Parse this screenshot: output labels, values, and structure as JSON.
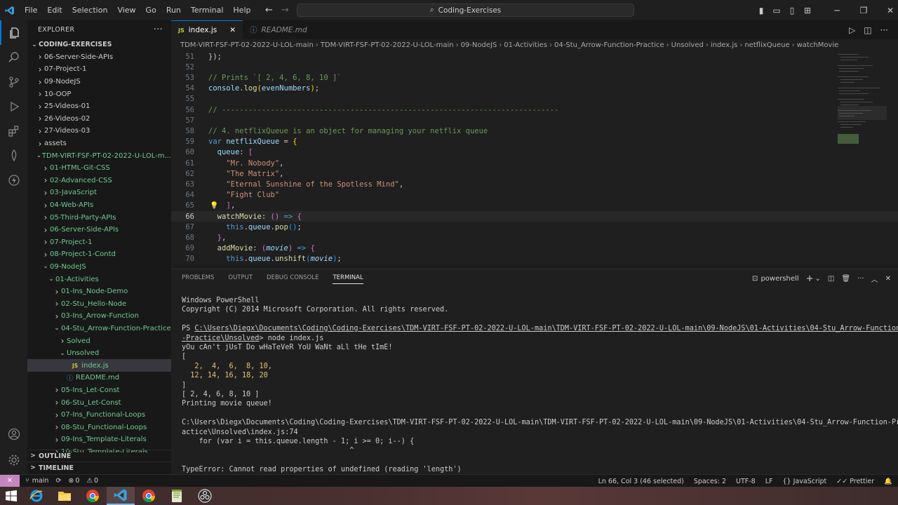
{
  "titlebar": {
    "menu": [
      "File",
      "Edit",
      "Selection",
      "View",
      "Go",
      "Run",
      "Terminal",
      "Help"
    ],
    "search_text": "Coding-Exercises"
  },
  "sidebar": {
    "title": "EXPLORER",
    "items": [
      {
        "label": "CODING-EXERCISES",
        "indent": 0,
        "chev": "v",
        "bold": true
      },
      {
        "label": "06-Server-Side-APIs",
        "indent": 1,
        "chev": ">"
      },
      {
        "label": "07-Project-1",
        "indent": 1,
        "chev": ">"
      },
      {
        "label": "09-NodeJS",
        "indent": 1,
        "chev": ">"
      },
      {
        "label": "10-OOP",
        "indent": 1,
        "chev": ">"
      },
      {
        "label": "25-Videos-01",
        "indent": 1,
        "chev": ">"
      },
      {
        "label": "26-Videos-02",
        "indent": 1,
        "chev": ">"
      },
      {
        "label": "27-Videos-03",
        "indent": 1,
        "chev": ">"
      },
      {
        "label": "assets",
        "indent": 1,
        "chev": ">"
      },
      {
        "label": "TDM-VIRT-FSF-PT-02-2022-U-LOL-m...",
        "indent": 1,
        "chev": "v",
        "green": true
      },
      {
        "label": "01-HTML-Git-CSS",
        "indent": 2,
        "chev": ">",
        "green": true
      },
      {
        "label": "02-Advanced-CSS",
        "indent": 2,
        "chev": ">",
        "green": true
      },
      {
        "label": "03-JavaScript",
        "indent": 2,
        "chev": ">",
        "green": true
      },
      {
        "label": "04-Web-APIs",
        "indent": 2,
        "chev": ">",
        "green": true
      },
      {
        "label": "05-Third-Party-APIs",
        "indent": 2,
        "chev": ">",
        "green": true
      },
      {
        "label": "06-Server-Side-APIs",
        "indent": 2,
        "chev": ">",
        "green": true
      },
      {
        "label": "07-Project-1",
        "indent": 2,
        "chev": ">",
        "green": true
      },
      {
        "label": "08-Project-1-Contd",
        "indent": 2,
        "chev": ">",
        "green": true
      },
      {
        "label": "09-NodeJS",
        "indent": 2,
        "chev": "v",
        "green": true
      },
      {
        "label": "01-Activities",
        "indent": 3,
        "chev": "v",
        "green": true
      },
      {
        "label": "01-Ins_Node-Demo",
        "indent": 4,
        "chev": ">",
        "green": true
      },
      {
        "label": "02-Stu_Hello-Node",
        "indent": 4,
        "chev": ">",
        "green": true
      },
      {
        "label": "03-Ins_Arrow-Function",
        "indent": 4,
        "chev": ">",
        "green": true
      },
      {
        "label": "04-Stu_Arrow-Function-Practice",
        "indent": 4,
        "chev": "v",
        "green": true
      },
      {
        "label": "Solved",
        "indent": 5,
        "chev": ">",
        "green": true
      },
      {
        "label": "Unsolved",
        "indent": 5,
        "chev": "v",
        "green": true
      },
      {
        "label": "index.js",
        "indent": 6,
        "chev": "",
        "green": true,
        "selected": true,
        "js": true
      },
      {
        "label": "README.md",
        "indent": 5,
        "chev": "",
        "green": true,
        "md": true
      },
      {
        "label": "05-Ins_Let-Const",
        "indent": 4,
        "chev": ">",
        "green": true
      },
      {
        "label": "06-Stu_Let-Const",
        "indent": 4,
        "chev": ">",
        "green": true
      },
      {
        "label": "07-Ins_Functional-Loops",
        "indent": 4,
        "chev": ">",
        "green": true
      },
      {
        "label": "08-Stu_Functional-Loops",
        "indent": 4,
        "chev": ">",
        "green": true
      },
      {
        "label": "09-Ins_Template-Literals",
        "indent": 4,
        "chev": ">",
        "green": true
      },
      {
        "label": "10-Stu_Template-Literals",
        "indent": 4,
        "chev": ">",
        "green": true
      }
    ],
    "outline": "OUTLINE",
    "timeline": "TIMELINE"
  },
  "tabs": [
    {
      "label": "index.js",
      "active": true
    },
    {
      "label": "README.md",
      "active": false
    }
  ],
  "breadcrumb": [
    "TDM-VIRT-FSF-PT-02-2022-U-LOL-main",
    "TDM-VIRT-FSF-PT-02-2022-U-LOL-main",
    "09-NodeJS",
    "01-Activities",
    "04-Stu_Arrow-Function-Practice",
    "Unsolved",
    "index.js",
    "netflixQueue",
    "watchMovie"
  ],
  "editor": {
    "lines": [
      {
        "n": "51",
        "html": "<span class='p'>});</span>"
      },
      {
        "n": "52",
        "html": ""
      },
      {
        "n": "53",
        "html": "<span class='c'>// Prints `[ 2, 4, 6, 8, 10 ]`</span>"
      },
      {
        "n": "54",
        "html": "<span class='v'>console</span><span class='p'>.</span><span class='f'>log</span><span class='y'>(</span><span class='v'>evenNumbers</span><span class='y'>)</span><span class='p'>;</span>"
      },
      {
        "n": "55",
        "html": ""
      },
      {
        "n": "56",
        "html": "<span class='c'>// ----------------------------------------------------------------------------</span>"
      },
      {
        "n": "57",
        "html": ""
      },
      {
        "n": "58",
        "html": "<span class='c'>// 4. netflixQueue is an object for managing your netflix queue</span>"
      },
      {
        "n": "59",
        "html": "<span class='k'>var</span> <span class='v'>netflixQueue</span> <span class='p'>=</span> <span class='y'>{</span>"
      },
      {
        "n": "60",
        "html": "  <span class='v'>queue</span><span class='p'>:</span> <span class='pk'>[</span>"
      },
      {
        "n": "61",
        "html": "    <span class='s'>\"Mr. Nobody\"</span><span class='p'>,</span>"
      },
      {
        "n": "62",
        "html": "    <span class='s'>\"The Matrix\"</span><span class='p'>,</span>"
      },
      {
        "n": "63",
        "html": "    <span class='s'>\"Eternal Sunshine of the Spotless Mind\"</span><span class='p'>,</span>"
      },
      {
        "n": "64",
        "html": "    <span class='s'>\"Fight Club\"</span>"
      },
      {
        "n": "65",
        "html": "  <span class='pk'>]</span><span class='p'>,</span>"
      },
      {
        "n": "66",
        "html": "  <span class='f'>watchMovie</span><span class='p'>:</span> <span class='pk'>()</span> <span class='k'>=&gt;</span> <span class='pk'>{</span>",
        "cur": true
      },
      {
        "n": "67",
        "html": "    <span class='k'>this</span><span class='p'>.</span><span class='v'>queue</span><span class='p'>.</span><span class='f'>pop</span><span class='b'>()</span><span class='p'>;</span>"
      },
      {
        "n": "68",
        "html": "  <span class='pk'>}</span><span class='p'>,</span>"
      },
      {
        "n": "69",
        "html": "  <span class='f'>addMovie</span><span class='p'>:</span> <span class='pk'>(</span><span class='v'><i>movie</i></span><span class='pk'>)</span> <span class='k'>=&gt;</span> <span class='pk'>{</span>"
      },
      {
        "n": "70",
        "html": "    <span class='k'>this</span><span class='p'>.</span><span class='v'>queue</span><span class='p'>.</span><span class='f'>unshift</span><span class='b'>(</span><span class='v'><i>movie</i></span><span class='b'>)</span><span class='p'>;</span>"
      }
    ]
  },
  "panel": {
    "tabs": [
      "PROBLEMS",
      "OUTPUT",
      "DEBUG CONSOLE",
      "TERMINAL"
    ],
    "shell": "powershell",
    "terminal_lines": [
      "Windows PowerShell",
      "Copyright (C) 2014 Microsoft Corporation. All rights reserved.",
      "",
      "PS C:\\Users\\Diegx\\Documents\\Coding\\Coding-Exercises\\TDM-VIRT-FSF-PT-02-2022-U-LOL-main\\TDM-VIRT-FSF-PT-02-2022-U-LOL-main\\09-NodeJS\\01-Activities\\04-Stu_Arrow-Function",
      "-Practice\\Unsolved> node index.js",
      "yOu cAn't jUsT Do wHaTeVeR YoU WaNt aLl tHe tImE!",
      "[",
      "   2,  4,  6,  8, 10,",
      "  12, 14, 16, 18, 20",
      "]",
      "[ 2, 4, 6, 8, 10 ]",
      "Printing movie queue!",
      "",
      "C:\\Users\\Diegx\\Documents\\Coding\\Coding-Exercises\\TDM-VIRT-FSF-PT-02-2022-U-LOL-main\\TDM-VIRT-FSF-PT-02-2022-U-LOL-main\\09-NodeJS\\01-Activities\\04-Stu_Arrow-Function-Pr",
      "actice\\Unsolved\\index.js:74",
      "    for (var i = this.queue.length - 1; i >= 0; i--) {",
      "                                       ^",
      "",
      "TypeError: Cannot read properties of undefined (reading 'length')"
    ]
  },
  "statusbar": {
    "branch": "main",
    "problems": "0",
    "warnings": "0",
    "position": "Ln 66, Col 3 (46 selected)",
    "spaces": "Spaces: 2",
    "encoding": "UTF-8",
    "eol": "LF",
    "language": "JavaScript",
    "formatter": "Prettier"
  },
  "colors": {
    "accent": "#0078d4",
    "remote": "#c586c0",
    "tree_green": "#73c991"
  }
}
